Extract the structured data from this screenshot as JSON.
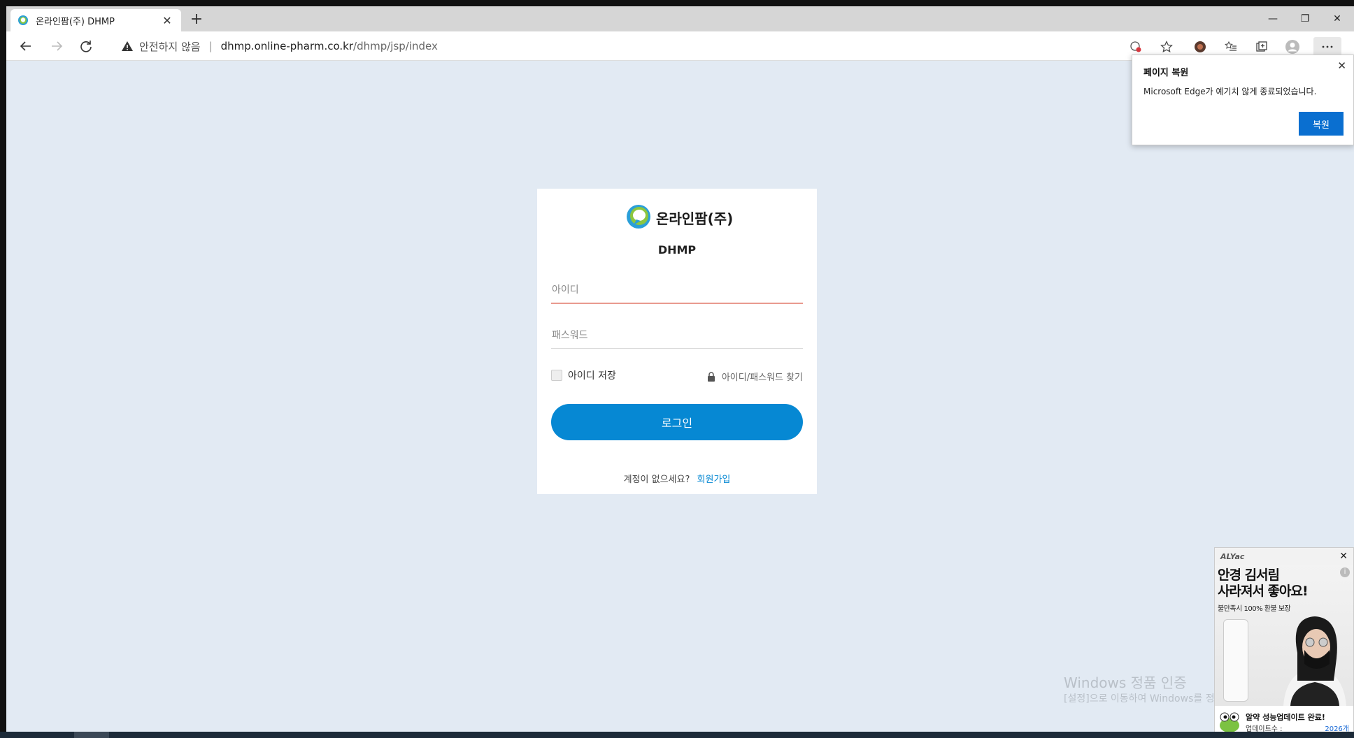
{
  "browser": {
    "tab_title": "온라인팜(주) DHMP",
    "new_tab": "+",
    "security_label": "안전하지 않음",
    "url_host": "dhmp.online-pharm.co.kr",
    "url_path": "/dhmp/jsp/index"
  },
  "restore_popup": {
    "title": "페이지 복원",
    "message": "Microsoft Edge가 예기치 않게 종료되었습니다.",
    "button": "복원"
  },
  "login": {
    "company": "온라인팜(주)",
    "system_name": "DHMP",
    "id_placeholder": "아이디",
    "password_placeholder": "패스워드",
    "remember_label": "아이디 저장",
    "find_label": "아이디/패스워드 찾기",
    "login_button": "로그인",
    "no_account": "계정이 없으세요?",
    "signup_link": "회원가입"
  },
  "watermark": {
    "line1": "Windows 정품 인증",
    "line2": "[설정]으로 이동하여 Windows를 정품 인증합니다."
  },
  "ad": {
    "brand": "ALYac",
    "headline1": "안경 김서림",
    "headline2": "사라져서 좋아요!",
    "subline": "불만족시 100% 환불 보장",
    "footer_title": "알약 성능업데이트 완료!",
    "footer_label": "업데이트수 :",
    "footer_count": "2026개"
  },
  "colors": {
    "page_bg": "#e2eaf3",
    "primary": "#0688d3",
    "edge_blue": "#0a6fd0",
    "input_focus": "#e99a8f"
  }
}
